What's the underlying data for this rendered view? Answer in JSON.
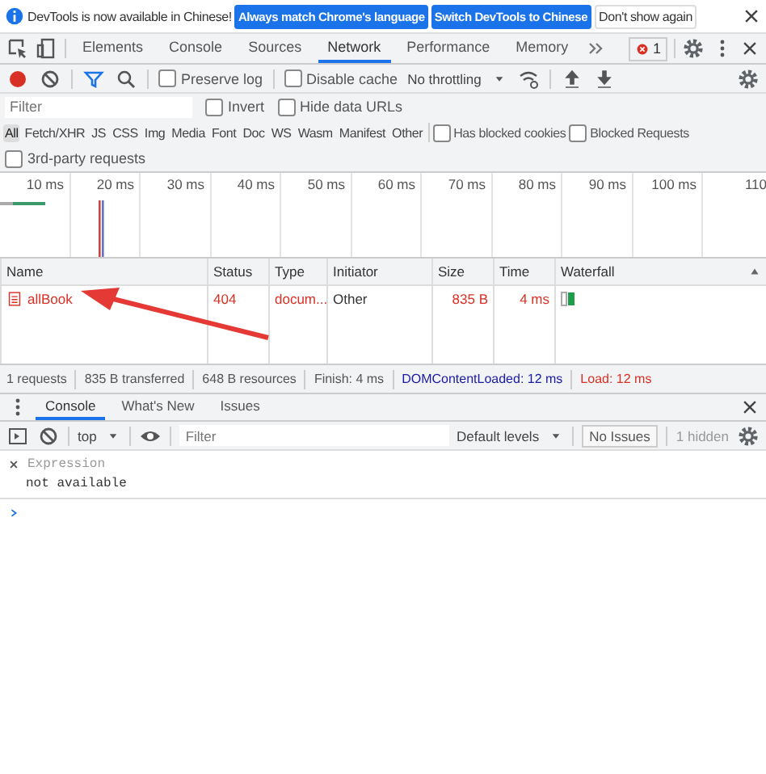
{
  "infobar": {
    "message": "DevTools is now available in Chinese!",
    "buttons": [
      {
        "label": "Always match Chrome's language",
        "kind": "primary"
      },
      {
        "label": "Switch DevTools to Chinese",
        "kind": "primary"
      },
      {
        "label": "Don't show again",
        "kind": "plain"
      }
    ]
  },
  "tabs": [
    {
      "label": "Elements",
      "selected": false
    },
    {
      "label": "Console",
      "selected": false
    },
    {
      "label": "Sources",
      "selected": false
    },
    {
      "label": "Network",
      "selected": true
    },
    {
      "label": "Performance",
      "selected": false
    },
    {
      "label": "Memory",
      "selected": false
    }
  ],
  "error_count": "1",
  "toolbar": {
    "recording": true,
    "preserve_log": {
      "label": "Preserve log",
      "checked": false
    },
    "disable_cache": {
      "label": "Disable cache",
      "checked": false
    },
    "throttling": "No throttling"
  },
  "filter": {
    "placeholder": "Filter",
    "options": [
      {
        "label": "Invert",
        "checked": false
      },
      {
        "label": "Hide data URLs",
        "checked": false
      }
    ]
  },
  "type_filters": [
    {
      "label": "All",
      "selected": true
    },
    {
      "label": "Fetch/XHR",
      "selected": false
    },
    {
      "label": "JS",
      "selected": false
    },
    {
      "label": "CSS",
      "selected": false
    },
    {
      "label": "Img",
      "selected": false
    },
    {
      "label": "Media",
      "selected": false
    },
    {
      "label": "Font",
      "selected": false
    },
    {
      "label": "Doc",
      "selected": false
    },
    {
      "label": "WS",
      "selected": false
    },
    {
      "label": "Wasm",
      "selected": false
    },
    {
      "label": "Manifest",
      "selected": false
    },
    {
      "label": "Other",
      "selected": false
    }
  ],
  "request_options": [
    {
      "label": "Has blocked cookies",
      "checked": false
    },
    {
      "label": "Blocked Requests",
      "checked": false
    },
    {
      "label": "3rd-party requests",
      "checked": false
    }
  ],
  "timeline_ticks": [
    "10 ms",
    "20 ms",
    "30 ms",
    "40 ms",
    "50 ms",
    "60 ms",
    "70 ms",
    "80 ms",
    "90 ms",
    "100 ms",
    "110"
  ],
  "table": {
    "columns": [
      "Name",
      "Status",
      "Type",
      "Initiator",
      "Size",
      "Time",
      "Waterfall"
    ],
    "rows": [
      {
        "name": "allBook",
        "status": "404",
        "type": "docum...",
        "initiator": "Other",
        "size": "835 B",
        "time": "4 ms",
        "error": true
      }
    ]
  },
  "status_bar": [
    {
      "text": "1 requests",
      "kind": "plain"
    },
    {
      "text": "835 B transferred",
      "kind": "plain"
    },
    {
      "text": "648 B resources",
      "kind": "plain"
    },
    {
      "text": "Finish: 4 ms",
      "kind": "plain"
    },
    {
      "text": "DOMContentLoaded: 12 ms",
      "kind": "dom"
    },
    {
      "text": "Load: 12 ms",
      "kind": "load"
    }
  ],
  "drawer_tabs": [
    {
      "label": "Console",
      "selected": true
    },
    {
      "label": "What's New",
      "selected": false
    },
    {
      "label": "Issues",
      "selected": false
    }
  ],
  "console_toolbar": {
    "context": "top",
    "placeholder": "Filter",
    "levels": "Default levels",
    "issues": "No Issues",
    "hidden": "1 hidden"
  },
  "expression": {
    "placeholder": "Expression",
    "value": "not available"
  }
}
